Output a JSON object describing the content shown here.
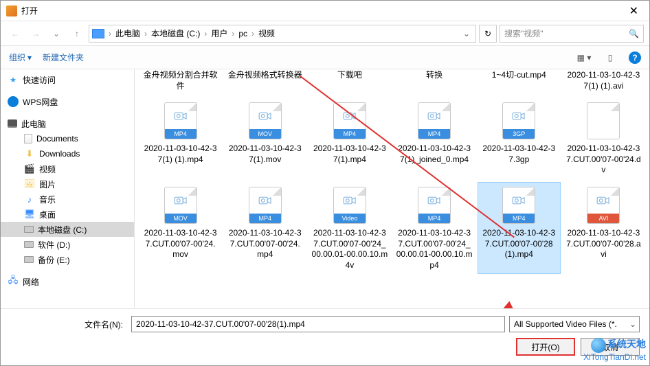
{
  "window": {
    "title": "打开"
  },
  "nav": {
    "crumbs": [
      "此电脑",
      "本地磁盘 (C:)",
      "用户",
      "pc",
      "视频"
    ],
    "search_placeholder": "搜索\"视频\""
  },
  "toolbar": {
    "organize": "组织",
    "new_folder": "新建文件夹"
  },
  "sidebar": {
    "quick_access": "快速访问",
    "wps": "WPS网盘",
    "this_pc": "此电脑",
    "documents": "Documents",
    "downloads": "Downloads",
    "videos": "视频",
    "pictures": "图片",
    "music": "音乐",
    "desktop": "桌面",
    "drive_c": "本地磁盘 (C:)",
    "drive_d": "软件 (D:)",
    "drive_e": "备份 (E:)",
    "network": "网络"
  },
  "files": {
    "row0": [
      {
        "name": "金舟视频分割合并软件"
      },
      {
        "name": "金舟视频格式转换器"
      },
      {
        "name": "下载吧"
      },
      {
        "name": "转换"
      },
      {
        "name": "1~4切-cut.mp4"
      },
      {
        "name": "2020-11-03-10-42-37(1) (1).avi"
      }
    ],
    "row1": [
      {
        "tag": "MP4",
        "name": "2020-11-03-10-42-37(1) (1).mp4"
      },
      {
        "tag": "MOV",
        "name": "2020-11-03-10-42-37(1).mov"
      },
      {
        "tag": "MP4",
        "name": "2020-11-03-10-42-37(1).mp4"
      },
      {
        "tag": "MP4",
        "name": "2020-11-03-10-42-37(1)_joined_0.mp4"
      },
      {
        "tag": "3GP",
        "name": "2020-11-03-10-42-37.3gp"
      },
      {
        "tag": "",
        "name": "2020-11-03-10-42-37.CUT.00'07-00'24.dv"
      }
    ],
    "row2": [
      {
        "tag": "MOV",
        "name": "2020-11-03-10-42-37.CUT.00'07-00'24.mov"
      },
      {
        "tag": "MP4",
        "name": "2020-11-03-10-42-37.CUT.00'07-00'24.mp4"
      },
      {
        "tag": "Video",
        "name": "2020-11-03-10-42-37.CUT.00'07-00'24_00.00.01-00.00.10.m4v"
      },
      {
        "tag": "MP4",
        "name": "2020-11-03-10-42-37.CUT.00'07-00'24_00.00.01-00.00.10.mp4"
      },
      {
        "tag": "MP4",
        "name": "2020-11-03-10-42-37.CUT.00'07-00'28(1).mp4",
        "selected": true
      },
      {
        "tag": "AVI",
        "name": "2020-11-03-10-42-37.CUT.00'07-00'28.avi"
      }
    ]
  },
  "footer": {
    "filename_label": "文件名(N):",
    "filename_value": "2020-11-03-10-42-37.CUT.00'07-00'28(1).mp4",
    "filetype": "All Supported Video Files (*.",
    "open": "打开(O)",
    "cancel": "取消"
  },
  "watermark": {
    "ch": "系统天地",
    "url": "XiTongTianDi.net"
  }
}
